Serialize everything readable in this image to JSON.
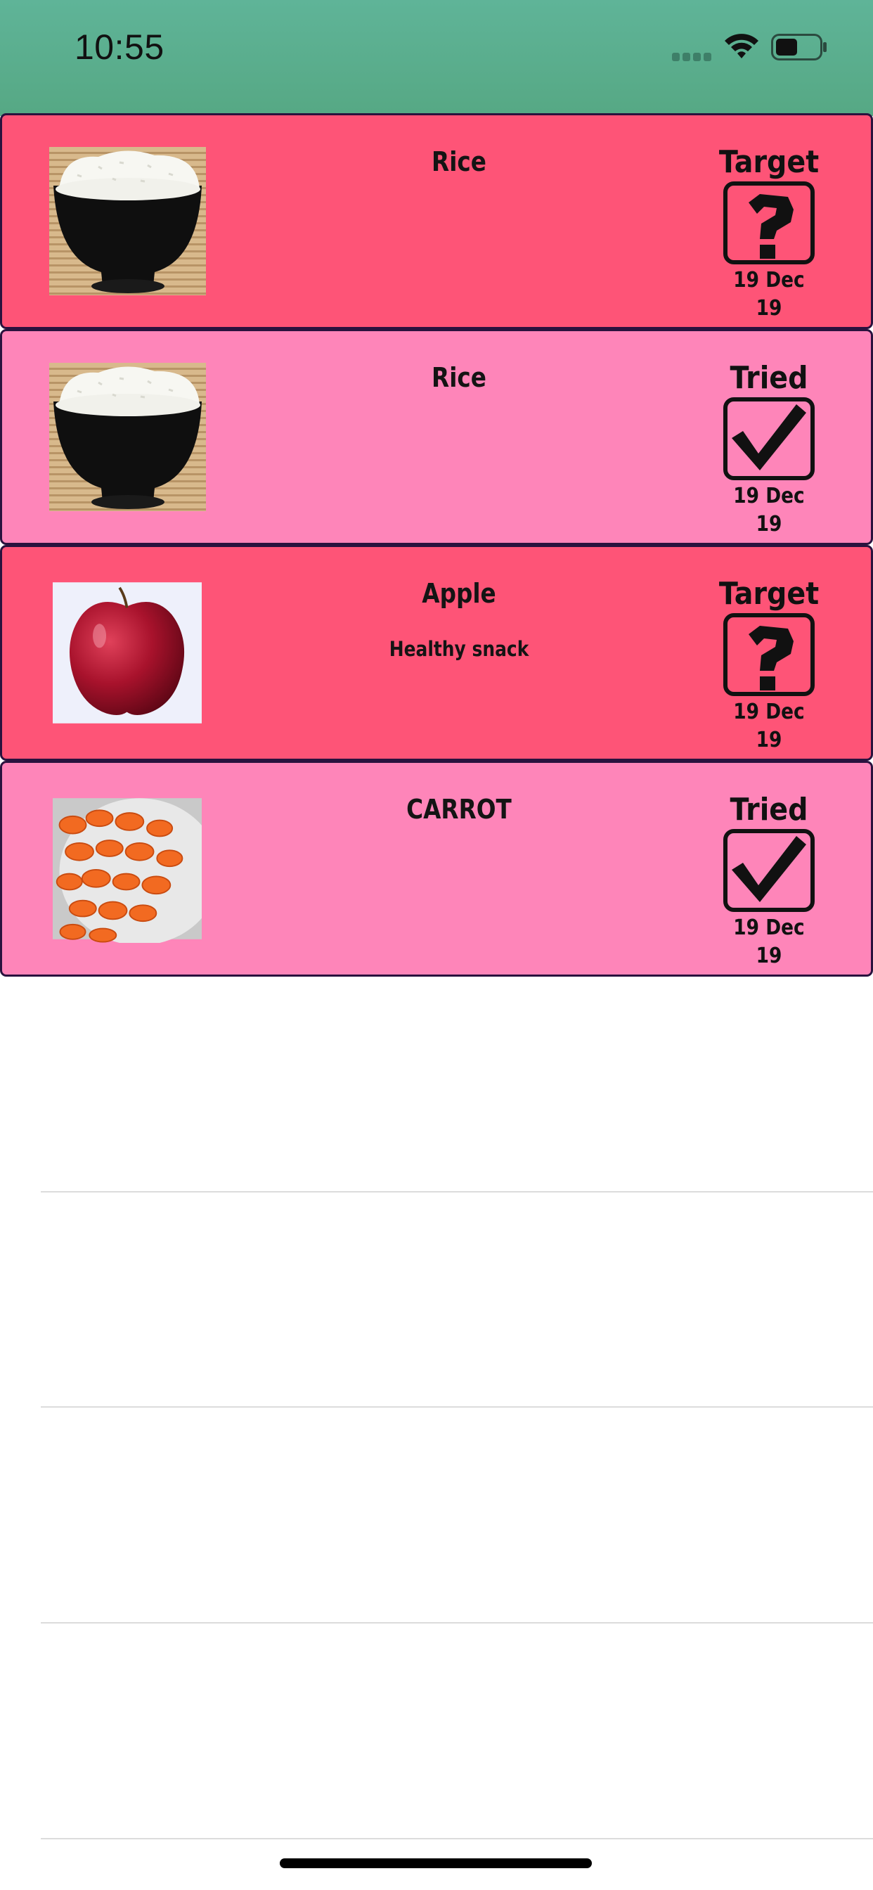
{
  "status_bar": {
    "time": "10:55",
    "icons": [
      "cellular-signal-icon",
      "wifi-icon",
      "battery-icon"
    ]
  },
  "food_list": [
    {
      "name": "Rice",
      "note": "",
      "status": "Target",
      "status_icon": "question-mark-box-icon",
      "date": "19 Dec 19",
      "photo": "rice-bowl"
    },
    {
      "name": "Rice",
      "note": "",
      "status": "Tried",
      "status_icon": "checkmark-box-icon",
      "date": "19 Dec 19",
      "photo": "rice-bowl"
    },
    {
      "name": "Apple",
      "note": "Healthy snack",
      "status": "Target",
      "status_icon": "question-mark-box-icon",
      "date": "19 Dec 19",
      "photo": "red-apple"
    },
    {
      "name": "CARROT",
      "note": "",
      "status": "Tried",
      "status_icon": "checkmark-box-icon",
      "date": "19 Dec 19",
      "photo": "sliced-carrots"
    }
  ],
  "colors": {
    "status_bar": "#5fb498",
    "target_card": "#fe5477",
    "tried_card": "#fe85b9",
    "card_border": "#2a123e"
  }
}
